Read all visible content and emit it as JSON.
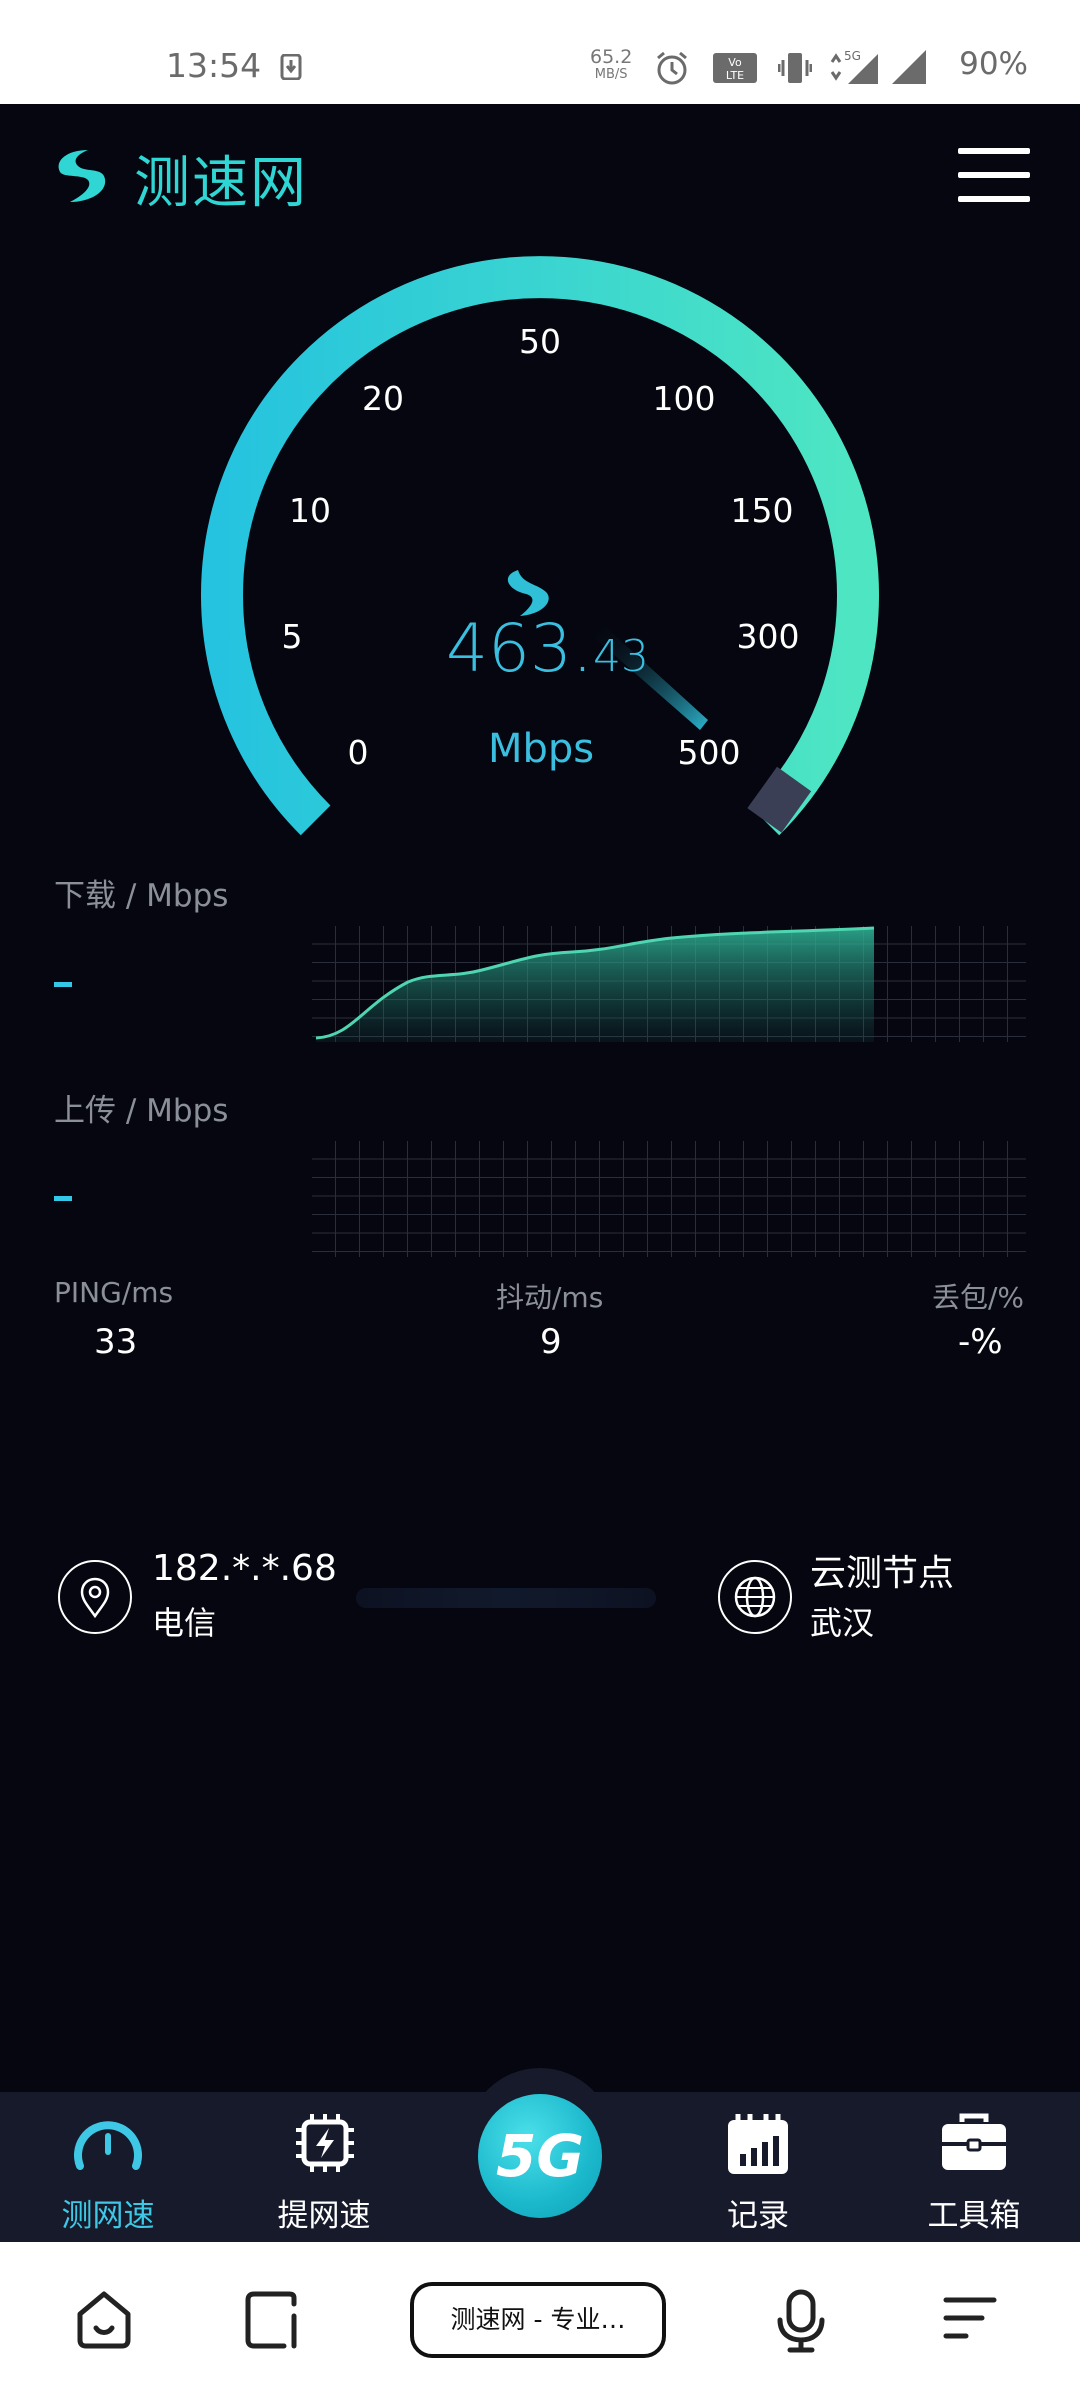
{
  "status": {
    "time": "13:54",
    "net_speed_value": "65.2",
    "net_speed_unit": "MB/S",
    "battery": "90%"
  },
  "app": {
    "name": "测速网",
    "accent": "#2fd6d3"
  },
  "gauge": {
    "ticks": [
      "0",
      "5",
      "10",
      "20",
      "50",
      "100",
      "150",
      "300",
      "500"
    ],
    "speed_int": "463.",
    "speed_dec": "43",
    "unit": "Mbps"
  },
  "download": {
    "label": "下载 / Mbps",
    "value": "-"
  },
  "upload": {
    "label": "上传 / Mbps",
    "value": "-"
  },
  "stats": {
    "ping_label": "PING/ms",
    "ping_value": "33",
    "jitter_label": "抖动/ms",
    "jitter_value": "9",
    "loss_label": "丢包/%",
    "loss_value": "-%"
  },
  "client": {
    "ip": "182.*.*.68",
    "isp": "电信"
  },
  "server": {
    "name": "云测节点",
    "city": "武汉"
  },
  "tabs": {
    "speed_test": "测网速",
    "boost": "提网速",
    "fiveg": "5G",
    "records": "记录",
    "toolbox": "工具箱"
  },
  "browser": {
    "url_text": "测速网 - 专业…"
  }
}
